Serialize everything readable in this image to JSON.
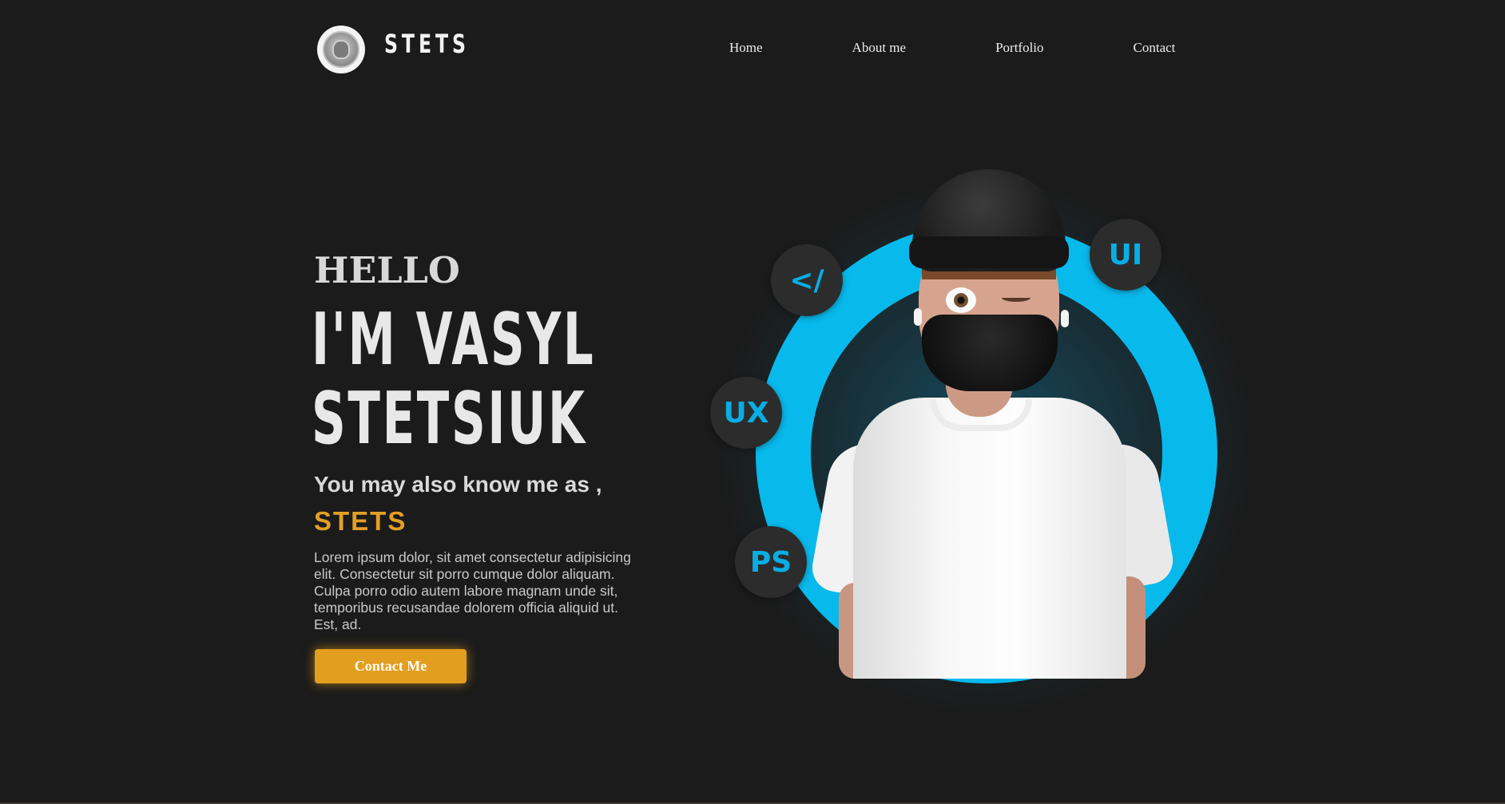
{
  "header": {
    "brand": "STETS",
    "nav": [
      "Home",
      "About me",
      "Portfolio",
      "Contact"
    ]
  },
  "hero": {
    "greeting": "HELLO",
    "name_line_1": "I'M VASYL",
    "name_line_2": "STETSIUK",
    "aka": "You may also know me as ,",
    "nickname": "STETS",
    "description": "Lorem ipsum dolor, sit amet consectetur adipisicing elit. Consectetur sit porro cumque dolor aliquam. Culpa porro odio autem labore magnam unde sit, temporibus recusandae dolorem officia aliquid ut. Est, ad.",
    "cta_label": "Contact Me"
  },
  "skills": {
    "code": "</",
    "ui": "UI",
    "ux": "UX",
    "ps": "PS"
  },
  "colors": {
    "background": "#1b1b1b",
    "accent_orange": "#e29e1f",
    "accent_blue": "#08b9ec"
  }
}
